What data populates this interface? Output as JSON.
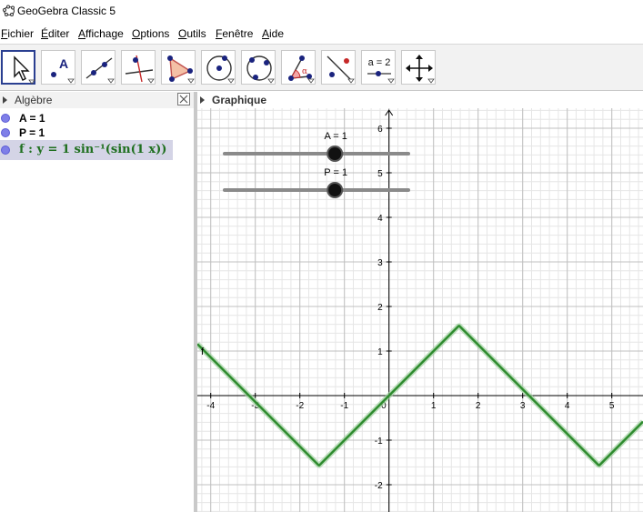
{
  "window": {
    "title": "GeoGebra Classic 5",
    "icon": "geogebra-logo-icon"
  },
  "menu": [
    {
      "label": "Fichier",
      "mnemonic": "F"
    },
    {
      "label": "Éditer",
      "mnemonic": "É"
    },
    {
      "label": "Affichage",
      "mnemonic": "A"
    },
    {
      "label": "Options",
      "mnemonic": "O"
    },
    {
      "label": "Outils",
      "mnemonic": "O"
    },
    {
      "label": "Fenêtre",
      "mnemonic": "F"
    },
    {
      "label": "Aide",
      "mnemonic": "A"
    }
  ],
  "toolbar": {
    "tools": [
      {
        "name": "move-tool-icon",
        "active": true
      },
      {
        "name": "point-tool-icon"
      },
      {
        "name": "line-tool-icon"
      },
      {
        "name": "perpendicular-line-tool-icon"
      },
      {
        "name": "polygon-tool-icon"
      },
      {
        "name": "circle-center-point-tool-icon"
      },
      {
        "name": "circle-three-points-tool-icon"
      },
      {
        "name": "angle-tool-icon"
      },
      {
        "name": "reflect-tool-icon"
      },
      {
        "name": "slider-tool-icon",
        "text": "a = 2"
      },
      {
        "name": "move-graphics-view-tool-icon"
      }
    ],
    "angle_symbol": "α"
  },
  "algebra": {
    "title": "Algèbre",
    "items": [
      {
        "text": "A = 1"
      },
      {
        "text": "P = 1"
      },
      {
        "text": "f : y = 1 sin⁻¹(sin(1 x))",
        "selected": true
      }
    ]
  },
  "graphics": {
    "title": "Graphique",
    "sliders": [
      {
        "label": "A = 1",
        "value": 1,
        "min": -5,
        "max": 5
      },
      {
        "label": "P = 1",
        "value": 1,
        "min": -5,
        "max": 5
      }
    ],
    "function_label": "f",
    "function": {
      "expression": "y = 1 sin⁻¹(sin(1 x))",
      "A": 1,
      "P": 1,
      "color": "#2e8b2e"
    },
    "axes": {
      "x_ticks": [
        "-4",
        "-3",
        "-2",
        "-1",
        "0",
        "1",
        "2",
        "3",
        "4",
        "5"
      ],
      "y_ticks": [
        "-2",
        "-1",
        "1",
        "2",
        "3",
        "4",
        "5",
        "6"
      ],
      "xlim": [
        -4.3,
        5.7
      ],
      "ylim": [
        -2.5,
        6.2
      ]
    },
    "colors": {
      "grid_major": "#c0c0c0",
      "grid_minor": "#e6e6e6",
      "axis": "#000000",
      "slider_track": "#8a8a8a"
    }
  }
}
